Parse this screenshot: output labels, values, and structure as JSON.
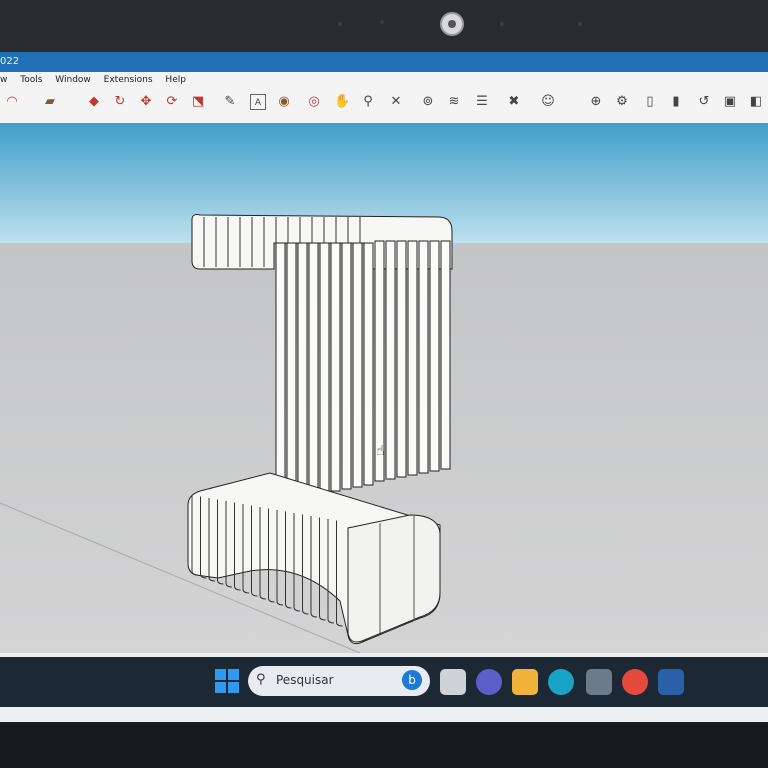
{
  "app": {
    "title": "022",
    "menu": [
      "w",
      "Tools",
      "Window",
      "Extensions",
      "Help"
    ]
  },
  "toolbars": {
    "row1_icons": [
      "arc-icon",
      "paint-icon",
      "push-pull-icon",
      "rotate-icon",
      "scale-icon",
      "tag-icon",
      "text-icon",
      "paint-bucket-icon",
      "orbit-icon",
      "pan-icon",
      "zoom-icon",
      "zoom-extents-icon",
      "component-icon",
      "intersect-icon",
      "layers-icon",
      "user-icon",
      "target-icon",
      "settings-icon",
      "door-icon",
      "door2-icon",
      "refresh-icon",
      "save-icon",
      "box-icon"
    ],
    "row2_icons": [
      "shape1-icon",
      "shape2-icon",
      "shape3-icon",
      "shape4-icon",
      "shape5-icon",
      "shape6-icon",
      "shape7-icon",
      "shape8-icon",
      "shape9-icon",
      "shape10-icon",
      "shape11-icon",
      "shape12-icon",
      "shape13-icon",
      "shape14-icon",
      "shape15-icon",
      "shape16-icon",
      "shape17-icon",
      "shape18-icon",
      "shape19-icon",
      "shape20-icon",
      "shape21-icon",
      "shape22-icon",
      "shape23-icon",
      "shape24-icon",
      "shape25-icon",
      "shape26-icon",
      "shape27-icon",
      "shape28-icon",
      "shape29-icon"
    ]
  },
  "taskbar": {
    "search_placeholder": "Pesquisar"
  },
  "colors": {
    "sky": "#5fb1d6",
    "ground": "#c8c9ca",
    "taskbar": "#1c2833",
    "titlebar": "#1f6fb2"
  }
}
